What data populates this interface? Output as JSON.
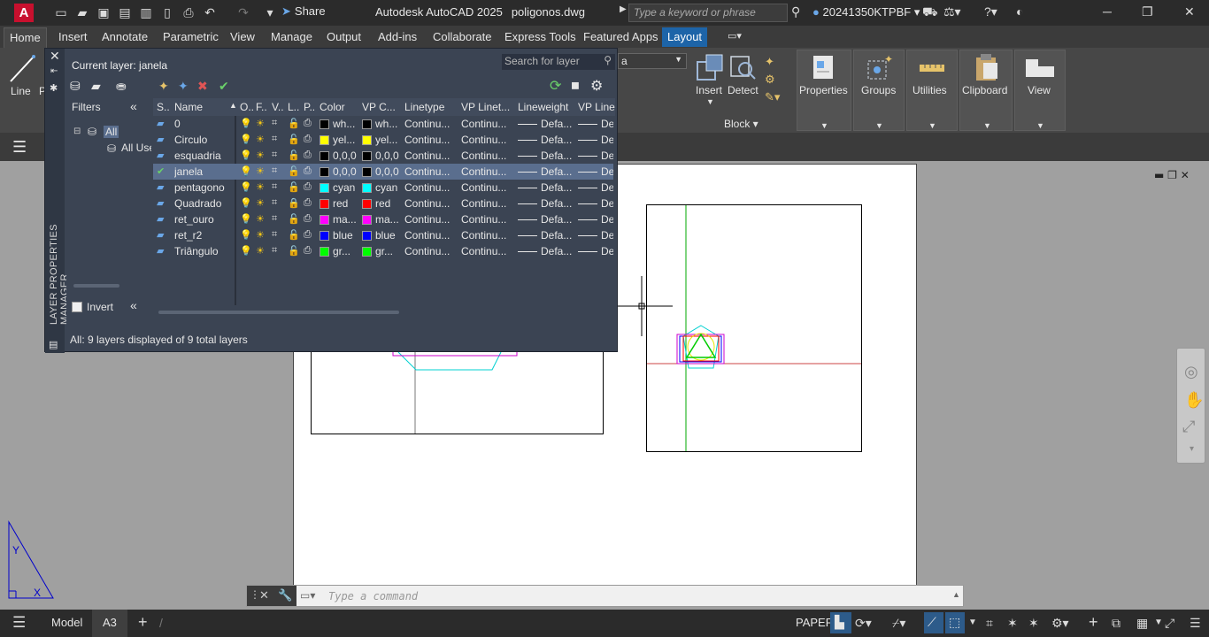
{
  "title_bar": {
    "app_letter": "A",
    "share_label": "Share",
    "app_name": "Autodesk AutoCAD 2025",
    "file_name": "poligonos.dwg",
    "search_placeholder": "Type a keyword or phrase",
    "user": "20241350KTPBF"
  },
  "ribbon_tabs": [
    "Home",
    "Insert",
    "Annotate",
    "Parametric",
    "View",
    "Manage",
    "Output",
    "Add-ins",
    "Collaborate",
    "Express Tools",
    "Featured Apps",
    "Layout"
  ],
  "ribbon": {
    "line_label": "Line",
    "p_label": "P",
    "insert_label": "Insert",
    "detect_label": "Detect",
    "block_group": "Block",
    "properties_label": "Properties",
    "groups_label": "Groups",
    "utilities_label": "Utilities",
    "clipboard_label": "Clipboard",
    "view_label": "View",
    "layer_combo_value": "a"
  },
  "layer_panel": {
    "vertical_title": "LAYER PROPERTIES MANAGER",
    "current_layer": "Current layer: janela",
    "search_placeholder": "Search for layer",
    "filters_label": "Filters",
    "filter_all": "All",
    "filter_all_used": "All Use",
    "invert_label": "Invert",
    "status": "All: 9 layers displayed of 9 total layers",
    "columns": [
      "S..",
      "Name",
      "O..",
      "F..",
      "V..",
      "L..",
      "P..",
      "Color",
      "VP C...",
      "Linetype",
      "VP Linet...",
      "Lineweight",
      "VP Line"
    ],
    "rows": [
      {
        "name": "0",
        "color_label": "wh...",
        "color": "#000000",
        "vp_color_label": "wh...",
        "vp_color": "#000000",
        "linetype": "Continu...",
        "vp_linetype": "Continu...",
        "lineweight": "Defa...",
        "vp_lineweight": "De",
        "locked": false,
        "current": false
      },
      {
        "name": "Circulo",
        "color_label": "yel...",
        "color": "#ffff00",
        "vp_color_label": "yel...",
        "vp_color": "#ffff00",
        "linetype": "Continu...",
        "vp_linetype": "Continu...",
        "lineweight": "Defa...",
        "vp_lineweight": "De",
        "locked": false,
        "current": false
      },
      {
        "name": "esquadria",
        "color_label": "0,0,0",
        "color": "#000000",
        "vp_color_label": "0,0,0",
        "vp_color": "#000000",
        "linetype": "Continu...",
        "vp_linetype": "Continu...",
        "lineweight": "Defa...",
        "vp_lineweight": "De",
        "locked": false,
        "current": false
      },
      {
        "name": "janela",
        "color_label": "0,0,0",
        "color": "#000000",
        "vp_color_label": "0,0,0",
        "vp_color": "#000000",
        "linetype": "Continu...",
        "vp_linetype": "Continu...",
        "lineweight": "Defa...",
        "vp_lineweight": "De",
        "locked": false,
        "current": true
      },
      {
        "name": "pentagono",
        "color_label": "cyan",
        "color": "#00ffff",
        "vp_color_label": "cyan",
        "vp_color": "#00ffff",
        "linetype": "Continu...",
        "vp_linetype": "Continu...",
        "lineweight": "Defa...",
        "vp_lineweight": "De",
        "locked": false,
        "current": false
      },
      {
        "name": "Quadrado",
        "color_label": "red",
        "color": "#ff0000",
        "vp_color_label": "red",
        "vp_color": "#ff0000",
        "linetype": "Continu...",
        "vp_linetype": "Continu...",
        "lineweight": "Defa...",
        "vp_lineweight": "De",
        "locked": true,
        "current": false
      },
      {
        "name": "ret_ouro",
        "color_label": "ma...",
        "color": "#ff00ff",
        "vp_color_label": "ma...",
        "vp_color": "#ff00ff",
        "linetype": "Continu...",
        "vp_linetype": "Continu...",
        "lineweight": "Defa...",
        "vp_lineweight": "De",
        "locked": false,
        "current": false
      },
      {
        "name": "ret_r2",
        "color_label": "blue",
        "color": "#0000ff",
        "vp_color_label": "blue",
        "vp_color": "#0000ff",
        "linetype": "Continu...",
        "vp_linetype": "Continu...",
        "lineweight": "Defa...",
        "vp_lineweight": "De",
        "locked": false,
        "current": false
      },
      {
        "name": "Triângulo",
        "color_label": "gr...",
        "color": "#00ff00",
        "vp_color_label": "gr...",
        "vp_color": "#00ff00",
        "linetype": "Continu...",
        "vp_linetype": "Continu...",
        "lineweight": "Defa...",
        "vp_lineweight": "De",
        "locked": false,
        "current": false
      }
    ]
  },
  "command_line": {
    "placeholder": "Type a command"
  },
  "status_bar": {
    "model_tab": "Model",
    "layout_tab": "A3",
    "paper_label": "PAPER"
  }
}
